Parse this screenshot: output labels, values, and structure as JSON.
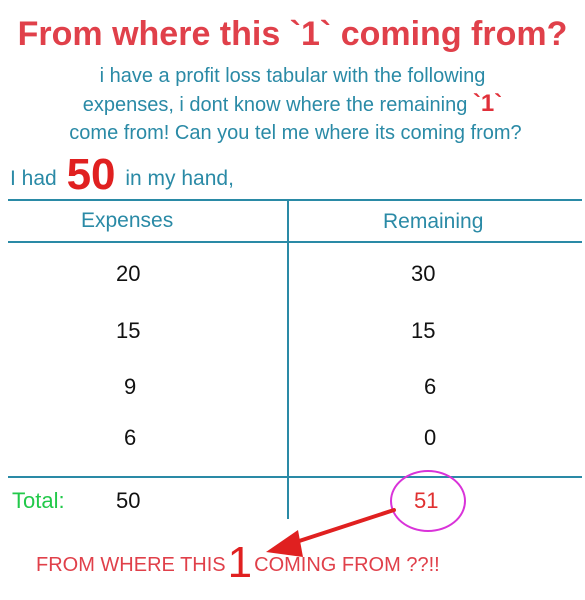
{
  "title": "From where this `1` coming from?",
  "intro": {
    "line1": "i have a profit loss tabular with the following",
    "line2_a": "expenses, i dont know where the remaining ",
    "line2_hl": "`1`",
    "line3": "come from! Can you tel me where its coming from?"
  },
  "had": {
    "prefix": "I had",
    "amount": "50",
    "suffix": "in my hand,"
  },
  "table": {
    "headers": {
      "expenses": "Expenses",
      "remaining": "Remaining"
    },
    "rows": [
      {
        "expense": "20",
        "remaining": "30"
      },
      {
        "expense": "15",
        "remaining": "15"
      },
      {
        "expense": "9",
        "remaining": "6"
      },
      {
        "expense": "6",
        "remaining": "0"
      }
    ],
    "total": {
      "label": "Total:",
      "expense": "50",
      "remaining": "51"
    }
  },
  "footer": {
    "prefix": "FROM WHERE THIS",
    "number": "1",
    "suffix": "COMING FROM ??!!"
  },
  "colors": {
    "title": "#e0404a",
    "body_text": "#2a8aa6",
    "highlight": "#e0303a",
    "total_label": "#22c94a",
    "circle": "#d933d9",
    "arrow": "#e02020"
  }
}
